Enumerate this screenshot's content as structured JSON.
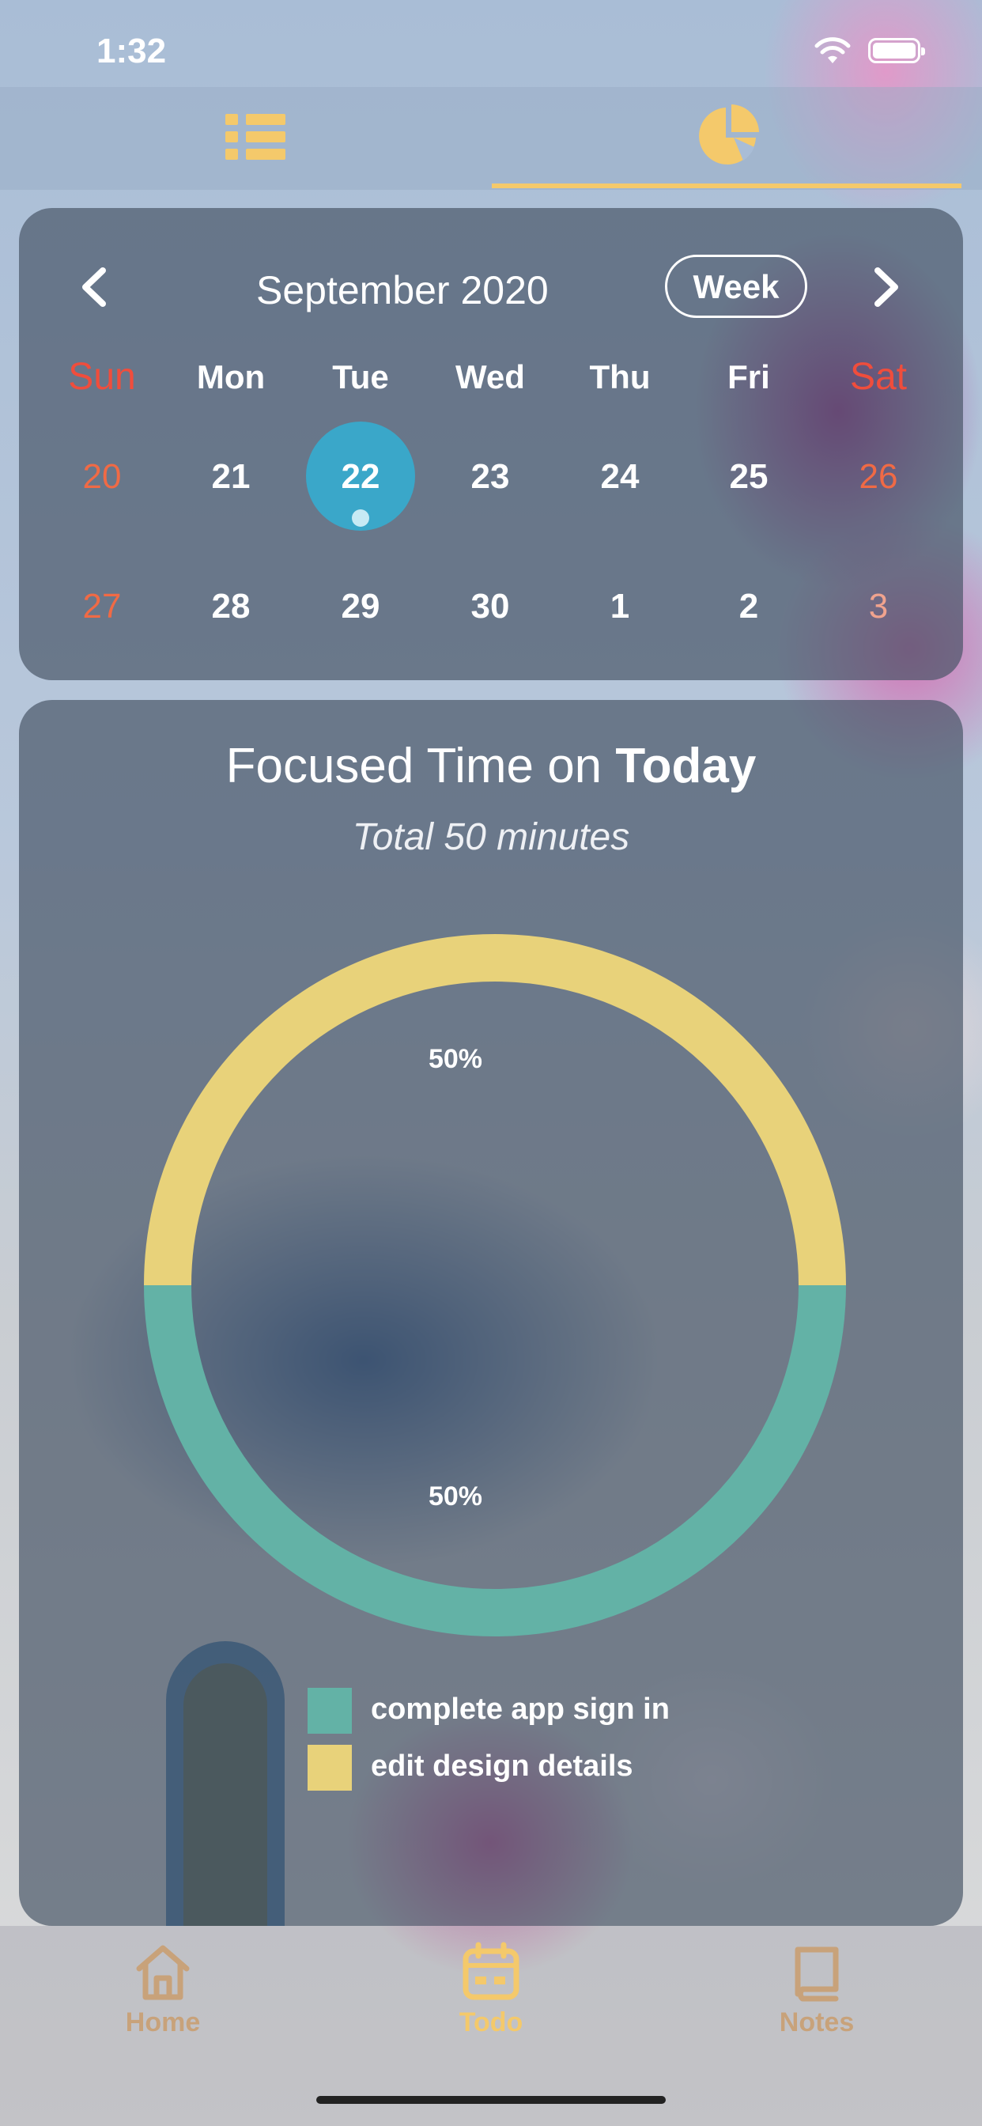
{
  "status_bar": {
    "time": "1:32"
  },
  "top_nav": {
    "active_tab": "chart"
  },
  "calendar": {
    "month_label": "September 2020",
    "view_button": "Week",
    "weekdays": [
      "Sun",
      "Mon",
      "Tue",
      "Wed",
      "Thu",
      "Fri",
      "Sat"
    ],
    "weeks": [
      [
        "20",
        "21",
        "22",
        "23",
        "24",
        "25",
        "26"
      ],
      [
        "27",
        "28",
        "29",
        "30",
        "1",
        "2",
        "3"
      ]
    ],
    "selected_day": "22"
  },
  "focus": {
    "title_prefix": "Focused Time on",
    "title_emphasis": "Today",
    "subtitle": "Total 50 minutes"
  },
  "chart_data": {
    "type": "pie",
    "title": "Focused Time on Today",
    "subtitle": "Total 50 minutes",
    "labels": [
      "edit design details",
      "complete app sign in"
    ],
    "values": [
      50,
      50
    ],
    "value_labels": [
      "50%",
      "50%"
    ],
    "colors": [
      "#e8d27a",
      "#63b2a6"
    ],
    "style": "donut",
    "legend_position": "bottom"
  },
  "legend": [
    {
      "label": "complete app sign in",
      "color": "#63b2a6"
    },
    {
      "label": "edit design details",
      "color": "#e8d27a"
    }
  ],
  "bottom_tabs": [
    {
      "label": "Home",
      "icon": "home-icon"
    },
    {
      "label": "Todo",
      "icon": "calendar-icon"
    },
    {
      "label": "Notes",
      "icon": "book-icon"
    }
  ],
  "colors": {
    "accent": "#f4c96b",
    "selected_day": "#3aa7c9",
    "weekend": "#f04d3c"
  }
}
